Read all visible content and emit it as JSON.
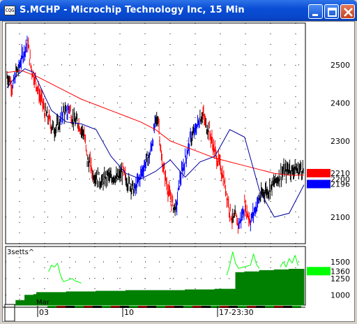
{
  "window": {
    "title": "S.MCHP - Microchip Technology Inc, 15 Min",
    "icon_label": "CQG",
    "buttons": [
      "minimize-icon",
      "maximize-icon",
      "close-icon"
    ]
  },
  "chart_data": [
    {
      "type": "line",
      "panel": "price",
      "title": "",
      "xlabel": "",
      "ylabel": "",
      "ylim": [
        2030,
        2610
      ],
      "yticks": [
        2100,
        2200,
        2300,
        2400,
        2500
      ],
      "grid": true,
      "series": [
        {
          "name": "",
          "style": "bars",
          "x": [
            0,
            0.01,
            0.02,
            0.03,
            0.04,
            0.05,
            0.06,
            0.07,
            0.08,
            0.09,
            0.1,
            0.11,
            0.12,
            0.13,
            0.14,
            0.15,
            0.16,
            0.17,
            0.18,
            0.19,
            0.2,
            0.21,
            0.22,
            0.23,
            0.24,
            0.25,
            0.26,
            0.27,
            0.28,
            0.29,
            0.3,
            0.31,
            0.32,
            0.33,
            0.34,
            0.35,
            0.36,
            0.37,
            0.38,
            0.39,
            0.4,
            0.41,
            0.42,
            0.43,
            0.44,
            0.45,
            0.46,
            0.47,
            0.48,
            0.49,
            0.5,
            0.51,
            0.52,
            0.53,
            0.54,
            0.55,
            0.56,
            0.57,
            0.58,
            0.59,
            0.6,
            0.61,
            0.62,
            0.63,
            0.64,
            0.65,
            0.66,
            0.67,
            0.68,
            0.69,
            0.7,
            0.71,
            0.72,
            0.73,
            0.74,
            0.75,
            0.76,
            0.77,
            0.78,
            0.79,
            0.8,
            0.81,
            0.82,
            0.83,
            0.84,
            0.85,
            0.86,
            0.87,
            0.88,
            0.89,
            0.9,
            0.91,
            0.92,
            0.93,
            0.94,
            0.95,
            0.96,
            0.97,
            0.98,
            0.99,
            1.0
          ],
          "y": [
            2470,
            2460,
            2440,
            2480,
            2490,
            2520,
            2540,
            2560,
            2500,
            2470,
            2450,
            2420,
            2400,
            2370,
            2360,
            2340,
            2330,
            2340,
            2350,
            2380,
            2370,
            2390,
            2360,
            2350,
            2350,
            2330,
            2320,
            2250,
            2240,
            2210,
            2210,
            2200,
            2190,
            2200,
            2210,
            2200,
            2210,
            2200,
            2210,
            2220,
            2200,
            2190,
            2180,
            2170,
            2190,
            2210,
            2230,
            2250,
            2260,
            2300,
            2350,
            2360,
            2250,
            2220,
            2180,
            2150,
            2130,
            2120,
            2190,
            2220,
            2250,
            2280,
            2310,
            2320,
            2340,
            2360,
            2370,
            2340,
            2330,
            2300,
            2270,
            2250,
            2230,
            2200,
            2160,
            2120,
            2090,
            2100,
            2080,
            2100,
            2130,
            2110,
            2090,
            2110,
            2130,
            2150,
            2160,
            2170,
            2170,
            2180,
            2190,
            2200,
            2210,
            2220,
            2220,
            2230,
            2220,
            2230,
            2220,
            2230,
            2220
          ],
          "color_up": "#0000ff",
          "color_down": "#ff0000",
          "color_neutral": "#000000"
        },
        {
          "name": "",
          "color": "#ff0000",
          "x": [
            0,
            0.05,
            0.1,
            0.15,
            0.2,
            0.25,
            0.3,
            0.35,
            0.4,
            0.45,
            0.5,
            0.55,
            0.6,
            0.65,
            0.7,
            0.75,
            0.8,
            0.85,
            0.9,
            0.95,
            1.0
          ],
          "y": [
            2480,
            2485,
            2470,
            2450,
            2430,
            2410,
            2395,
            2380,
            2365,
            2350,
            2330,
            2300,
            2285,
            2270,
            2255,
            2245,
            2235,
            2225,
            2215,
            2210,
            2210
          ]
        },
        {
          "name": "",
          "color": "#00009c",
          "x": [
            0,
            0.03,
            0.06,
            0.09,
            0.12,
            0.15,
            0.2,
            0.25,
            0.3,
            0.35,
            0.4,
            0.45,
            0.5,
            0.55,
            0.6,
            0.65,
            0.7,
            0.75,
            0.8,
            0.85,
            0.9,
            0.95,
            1.0
          ],
          "y": [
            2440,
            2470,
            2490,
            2480,
            2430,
            2380,
            2350,
            2345,
            2330,
            2260,
            2215,
            2200,
            2220,
            2250,
            2205,
            2245,
            2260,
            2330,
            2310,
            2170,
            2100,
            2110,
            2185
          ]
        }
      ],
      "last_values": [
        {
          "label": "2210",
          "color": "#ff0000"
        },
        {
          "label": "2196",
          "color": "#0000ff"
        }
      ]
    },
    {
      "type": "area",
      "panel": "volume",
      "title": "3setts^",
      "ylim": [
        850,
        1730
      ],
      "yticks": [
        1000,
        1250,
        1500
      ],
      "grid": true,
      "series": [
        {
          "name": "",
          "color": "#008000",
          "x": [
            0,
            0.03,
            0.06,
            0.09,
            0.1,
            0.2,
            0.3,
            0.4,
            0.5,
            0.6,
            0.7,
            0.76,
            0.77,
            0.8,
            0.85,
            0.9,
            0.95,
            1.0
          ],
          "y": [
            860,
            920,
            1000,
            1010,
            1040,
            1050,
            1060,
            1070,
            1070,
            1080,
            1090,
            1090,
            1340,
            1350,
            1370,
            1380,
            1390,
            1380
          ]
        },
        {
          "name": "",
          "color": "#00ff00",
          "x": [
            0.14,
            0.15,
            0.16,
            0.17,
            0.18,
            0.19,
            0.22,
            0.23,
            0.24,
            0.25,
            0.74,
            0.75,
            0.76,
            0.77,
            0.78,
            0.82,
            0.83,
            0.84,
            0.85,
            0.92,
            0.93,
            0.94,
            0.95,
            0.96,
            0.97,
            0.98
          ],
          "y": [
            1350,
            1450,
            1420,
            1480,
            1300,
            1200,
            1250,
            1210,
            1200,
            1180,
            1300,
            1450,
            1650,
            1470,
            1400,
            1450,
            1620,
            1460,
            1400,
            1420,
            1500,
            1420,
            1550,
            1480,
            1600,
            1440
          ]
        }
      ],
      "last_values": [
        {
          "label": "1360",
          "color": "#00ff00"
        }
      ]
    }
  ],
  "time_axis": {
    "month_label": "Mar",
    "ticks": [
      "03",
      "10",
      "17"
    ],
    "cursor_label": "17-23:30"
  }
}
